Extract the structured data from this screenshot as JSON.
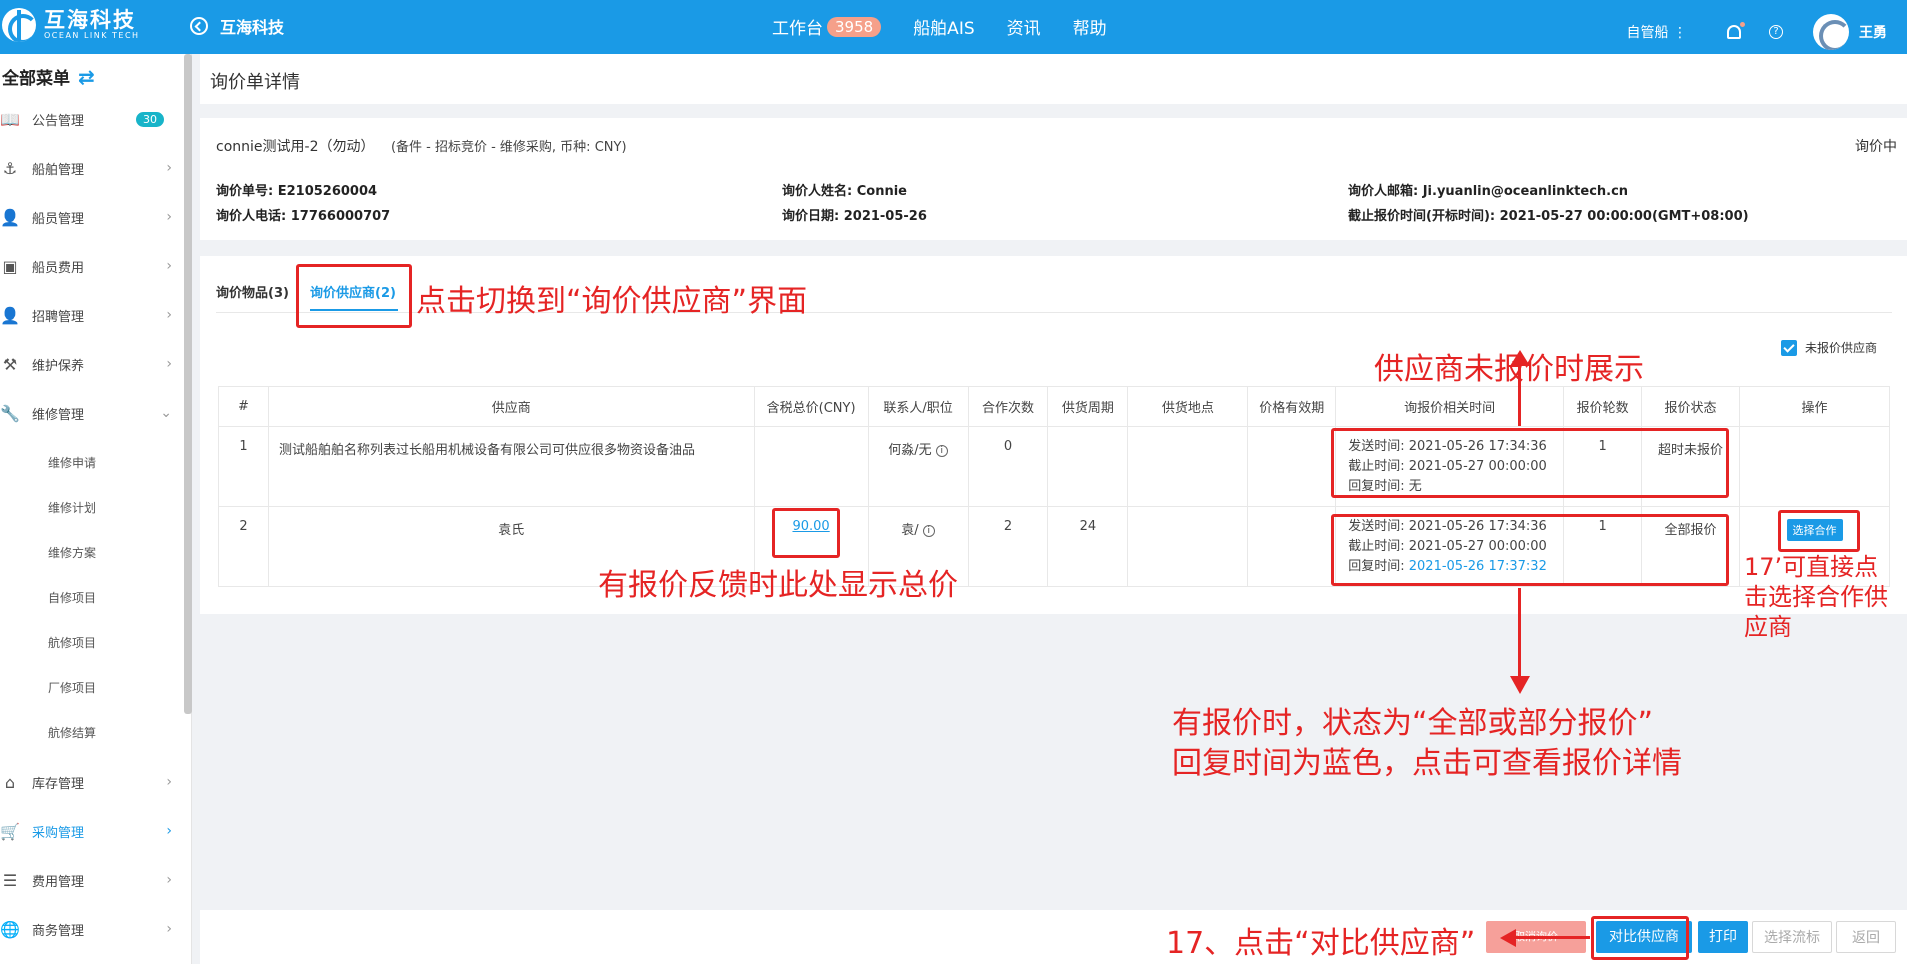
{
  "header": {
    "logo_cn": "互海科技",
    "logo_en": "OCEAN LINK TECH",
    "back_label": "互海科技",
    "nav": [
      {
        "label": "工作台",
        "badge": "3958"
      },
      {
        "label": "船舶AIS"
      },
      {
        "label": "资讯"
      },
      {
        "label": "帮助"
      }
    ],
    "ship_select": "自管船 ⋮",
    "help_glyph": "?",
    "user_name": "王勇"
  },
  "sidebar": {
    "title": "全部菜单",
    "swap_glyph": "⇄",
    "items": [
      {
        "label": "公告管理",
        "icon": "📖",
        "count": "30"
      },
      {
        "label": "船舶管理",
        "icon": "⚓",
        "arrow": "›"
      },
      {
        "label": "船员管理",
        "icon": "👤",
        "arrow": "›"
      },
      {
        "label": "船员费用",
        "icon": "▣",
        "arrow": "›"
      },
      {
        "label": "招聘管理",
        "icon": "👤",
        "arrow": "›"
      },
      {
        "label": "维护保养",
        "icon": "⚒",
        "arrow": "›"
      },
      {
        "label": "维修管理",
        "icon": "🔧",
        "arrow": "⌄"
      }
    ],
    "sub_items": [
      "维修申请",
      "维修计划",
      "维修方案",
      "自修项目",
      "航修项目",
      "厂修项目",
      "航修结算"
    ],
    "bottom_items": [
      {
        "label": "库存管理",
        "icon": "⌂",
        "arrow": "›"
      },
      {
        "label": "采购管理",
        "icon": "🛒",
        "arrow": "›"
      },
      {
        "label": "费用管理",
        "icon": "☰",
        "arrow": "›"
      },
      {
        "label": "商务管理",
        "icon": "🌐",
        "arrow": "›"
      }
    ]
  },
  "page": {
    "title": "询价单详情",
    "inquiry_name": "connie测试用-2（勿动）",
    "inquiry_desc": "(备件 - 招标竞价 - 维修采购, 币种: CNY)",
    "status": "询价中",
    "fields": [
      "询价单号: E2105260004",
      "询价人姓名: Connie",
      "询价人邮箱: Ji.yuanlin@oceanlinktech.cn",
      "询价人电话: 17766000707",
      "询价日期: 2021-05-26",
      "截止报价时间(开标时间): 2021-05-27 00:00:00(GMT+08:00)"
    ]
  },
  "tabs": [
    "询价物品(3)",
    "询价供应商(2)"
  ],
  "filter_label": "未报价供应商",
  "table": {
    "headers": [
      "#",
      "供应商",
      "含税总价(CNY)",
      "联系人/职位",
      "合作次数",
      "供货周期",
      "供货地点",
      "价格有效期",
      "询报价相关时间",
      "报价轮数",
      "报价状态",
      "操作"
    ],
    "rows": [
      {
        "index": "1",
        "supplier": "测试船舶舶名称列表过长船用机械设备有限公司可供应很多物资设备油品",
        "price": "",
        "contact": "何淼/无",
        "coop": "0",
        "cycle": "",
        "place": "",
        "validity": "",
        "sent": "发送时间: 2021-05-26 17:34:36",
        "deadline": "截止时间: 2021-05-27 00:00:00",
        "reply_label": "回复时间: ",
        "reply": "无",
        "rounds": "1",
        "status": "超时未报价",
        "action": ""
      },
      {
        "index": "2",
        "supplier": "袁氏",
        "price": "90.00",
        "contact": "袁/",
        "coop": "2",
        "cycle": "24",
        "place": "",
        "validity": "",
        "sent": "发送时间: 2021-05-26 17:34:36",
        "deadline": "截止时间: 2021-05-27 00:00:00",
        "reply_label": "回复时间: ",
        "reply": "2021-05-26 17:37:32",
        "rounds": "1",
        "status": "全部报价",
        "action": "选择合作"
      }
    ]
  },
  "bottom_buttons": {
    "faded": "取消询价",
    "compare": "对比供应商",
    "print": "打印",
    "flow": "选择流标",
    "back": "返回"
  },
  "annotations": {
    "a1": "点击切换到“询价供应商”界面",
    "a2": "供应商未报价时展示",
    "a3": "有报价反馈时此处显示总价",
    "a4_l1": "17’可直接点",
    "a4_l2": "击选择合作供",
    "a4_l3": "应商",
    "a5_l1": "有报价时，状态为“全部或部分报价”",
    "a5_l2": "回复时间为蓝色，点击可查看报价详情",
    "a6": "17、点击“对比供应商”"
  },
  "colors": {
    "primary": "#1a9ae6",
    "annotation": "#e52424"
  }
}
